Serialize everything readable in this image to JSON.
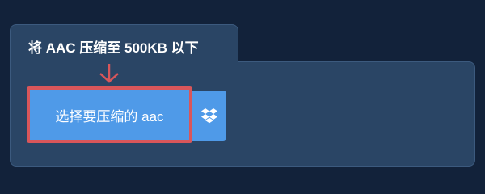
{
  "tab": {
    "title": "将 AAC 压缩至 500KB 以下"
  },
  "upload": {
    "choose_label": "选择要压缩的 aac",
    "dropbox_icon": "dropbox-icon"
  },
  "colors": {
    "background": "#12223a",
    "panel": "#2a4565",
    "button": "#4f9ae8",
    "highlight": "#d9565a"
  }
}
